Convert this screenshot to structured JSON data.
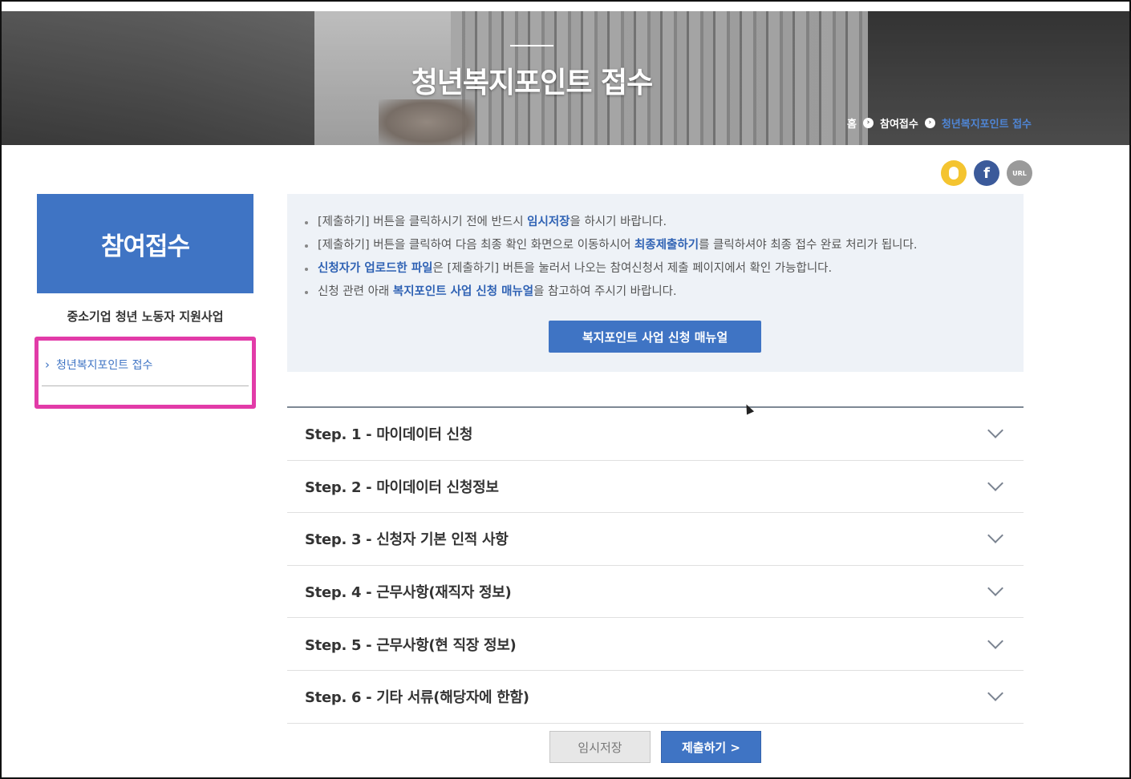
{
  "hero": {
    "title": "청년복지포인트 접수",
    "breadcrumb": {
      "home": "홈",
      "level1": "참여접수",
      "current": "청년복지포인트 접수"
    }
  },
  "share": {
    "kakao_icon": "kakao-icon",
    "facebook_icon": "facebook-icon",
    "facebook_glyph": "f",
    "url_icon": "url-icon",
    "url_label": "URL"
  },
  "sidebar": {
    "title": "참여접수",
    "subtitle": "중소기업 청년 노동자 지원사업",
    "items": [
      {
        "label": "청년복지포인트 접수",
        "active": true
      }
    ]
  },
  "notice": {
    "items": [
      {
        "before": "[제출하기] 버튼을 클릭하시기 전에 반드시 ",
        "highlight": "임시저장",
        "after": "을 하시기 바랍니다."
      },
      {
        "before": "[제출하기] 버튼을 클릭하여 다음 최종 확인 화면으로 이동하시어 ",
        "highlight": "최종제출하기",
        "after": "를 클릭하셔야 최종 접수 완료 처리가 됩니다."
      },
      {
        "before": "",
        "highlight": "신청자가 업로드한 파일",
        "after": "은 [제출하기] 버튼을 눌러서 나오는 참여신청서 제출 페이지에서 확인 가능합니다."
      },
      {
        "before": "신청 관련 아래 ",
        "highlight": "복지포인트 사업 신청 매뉴얼",
        "after": "을 참고하여 주시기 바랍니다."
      }
    ],
    "manual_button": "복지포인트 사업 신청 매뉴얼"
  },
  "steps": [
    {
      "label": "Step. 1 - 마이데이터 신청"
    },
    {
      "label": "Step. 2 - 마이데이터 신청정보"
    },
    {
      "label": "Step. 3 - 신청자 기본 인적 사항"
    },
    {
      "label": "Step. 4 - 근무사항(재직자 정보)"
    },
    {
      "label": "Step. 5 - 근무사항(현 직장 정보)"
    },
    {
      "label": "Step. 6 - 기타 서류(해당자에 한함)"
    }
  ],
  "actions": {
    "save_label": "임시저장",
    "submit_label": "제출하기 >"
  },
  "colors": {
    "primary": "#3f74c4",
    "highlight_box": "#e23ba8",
    "notice_bg": "#eef2f7"
  }
}
